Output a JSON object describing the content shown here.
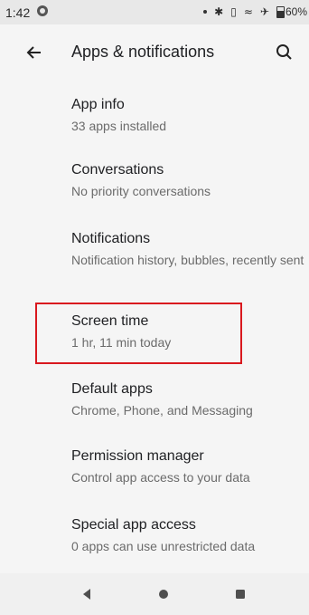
{
  "status_bar": {
    "time": "1:42",
    "battery_text": "60%"
  },
  "toolbar": {
    "title": "Apps & notifications",
    "back_icon": "arrow-left-icon",
    "search_icon": "search-icon"
  },
  "items": [
    {
      "title": "App info",
      "subtitle": "33 apps installed"
    },
    {
      "title": "Conversations",
      "subtitle": "No priority conversations"
    },
    {
      "title": "Notifications",
      "subtitle": "Notification history, bubbles, recently sent"
    },
    {
      "title": "Screen time",
      "subtitle": "1 hr, 11 min today"
    },
    {
      "title": "Default apps",
      "subtitle": "Chrome, Phone, and Messaging"
    },
    {
      "title": "Permission manager",
      "subtitle": "Control app access to your data"
    },
    {
      "title": "Special app access",
      "subtitle": "0 apps can use unrestricted data"
    }
  ],
  "nav": {
    "back_icon": "triangle-back-icon",
    "home_icon": "circle-home-icon",
    "recents_icon": "square-recents-icon"
  },
  "colors": {
    "highlight": "#d9181e",
    "background": "#f5f5f5",
    "secondary_text": "#6b6b6b"
  }
}
